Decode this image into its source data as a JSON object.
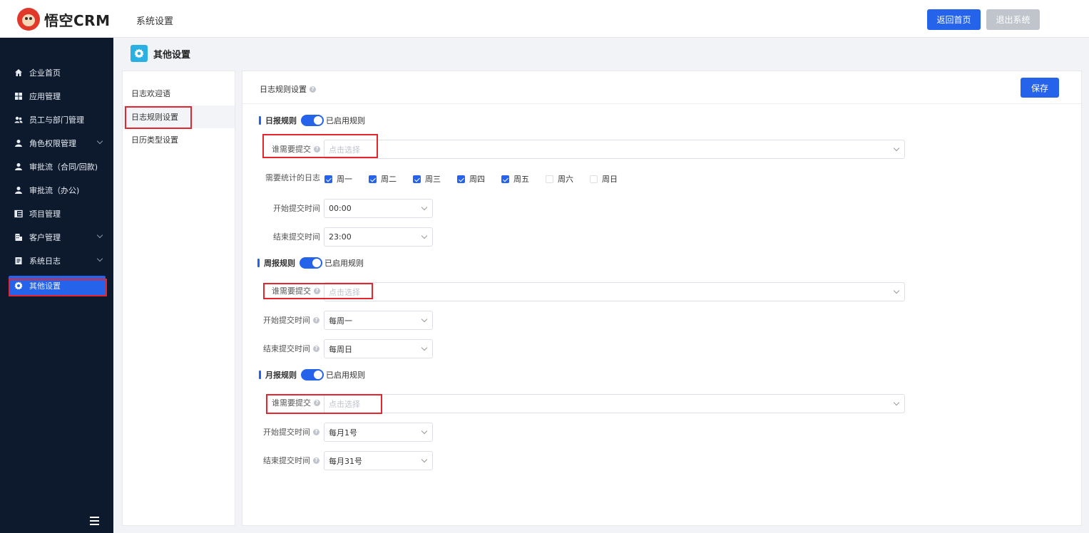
{
  "header": {
    "logo_text": "悟空CRM",
    "title": "系统设置",
    "home_button": "返回首页",
    "exit_button": "退出系统"
  },
  "sidebar": {
    "items": [
      {
        "label": "企业首页",
        "icon": "home-icon"
      },
      {
        "label": "应用管理",
        "icon": "apps-icon"
      },
      {
        "label": "员工与部门管理",
        "icon": "users-icon"
      },
      {
        "label": "角色权限管理",
        "icon": "user-icon"
      },
      {
        "label": "审批流（合同/回款)",
        "icon": "user-icon"
      },
      {
        "label": "审批流（办公)",
        "icon": "user-icon"
      },
      {
        "label": "项目管理",
        "icon": "project-icon"
      },
      {
        "label": "客户管理",
        "icon": "building-icon"
      },
      {
        "label": "系统日志",
        "icon": "log-icon"
      },
      {
        "label": "其他设置",
        "icon": "gear-icon"
      }
    ]
  },
  "page": {
    "title": "其他设置"
  },
  "submenu": {
    "items": [
      {
        "label": "日志欢迎语"
      },
      {
        "label": "日志规则设置"
      },
      {
        "label": "日历类型设置"
      }
    ]
  },
  "main": {
    "title": "日志规则设置",
    "save_button": "保存",
    "daily": {
      "title": "日报规则",
      "switch_label": "已启用规则",
      "submit_label": "谁需要提交",
      "submit_placeholder": "点击选择",
      "stat_label": "需要统计的日志",
      "days": [
        {
          "label": "周一",
          "checked": true
        },
        {
          "label": "周二",
          "checked": true
        },
        {
          "label": "周三",
          "checked": true
        },
        {
          "label": "周四",
          "checked": true
        },
        {
          "label": "周五",
          "checked": true
        },
        {
          "label": "周六",
          "checked": false
        },
        {
          "label": "周日",
          "checked": false
        }
      ],
      "start_label": "开始提交时间",
      "start_value": "00:00",
      "end_label": "结束提交时间",
      "end_value": "23:00"
    },
    "weekly": {
      "title": "周报规则",
      "switch_label": "已启用规则",
      "submit_label": "谁需要提交",
      "submit_placeholder": "点击选择",
      "start_label": "开始提交时间",
      "start_value": "每周一",
      "end_label": "结束提交时间",
      "end_value": "每周日"
    },
    "monthly": {
      "title": "月报规则",
      "switch_label": "已启用规则",
      "submit_label": "谁需要提交",
      "submit_placeholder": "点击选择",
      "start_label": "开始提交时间",
      "start_value": "每月1号",
      "end_label": "结束提交时间",
      "end_value": "每月31号"
    }
  },
  "colors": {
    "primary": "#2563eb",
    "sidebar_bg": "#0d1a2e",
    "highlight_red": "#e5262f"
  }
}
